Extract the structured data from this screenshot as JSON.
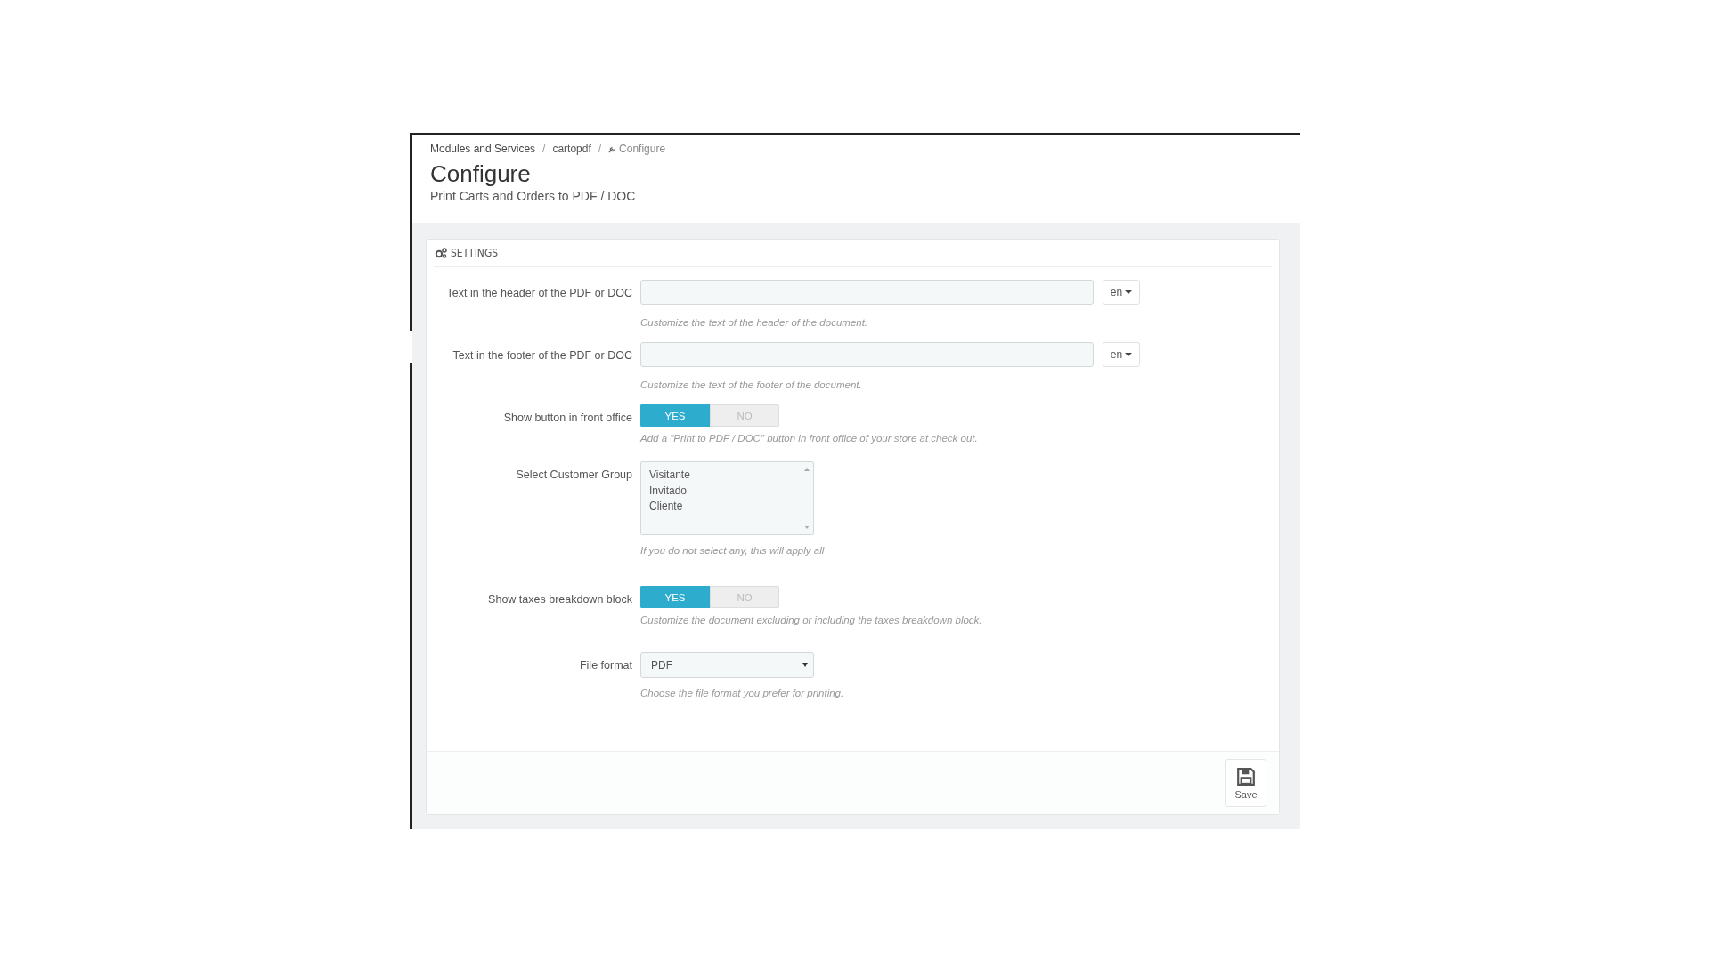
{
  "breadcrumb": [
    {
      "label": "Modules and Services",
      "kind": "link"
    },
    {
      "separator": "/",
      "label": "cartopdf",
      "kind": "link"
    },
    {
      "separator": "/",
      "label": "Configure",
      "kind": "current"
    }
  ],
  "page": {
    "title": "Configure",
    "subtitle": "Print Carts and Orders to PDF / DOC"
  },
  "panel": {
    "title": "SETTINGS"
  },
  "fields": [
    {
      "kind": "text",
      "label": "Text in the header of the PDF or DOC",
      "language": "en",
      "help": "Customize the text of the header of the document."
    },
    {
      "kind": "text",
      "label": "Text in the footer of the PDF or DOC",
      "language": "en",
      "help": "Customize the text of the footer of the document."
    },
    {
      "kind": "toggle",
      "label": "Show button in front office",
      "options": [
        {
          "label": "YES",
          "selected": true
        },
        {
          "label": "NO",
          "selected": false
        }
      ],
      "help": "Add a \"Print to PDF / DOC\" button in front office of your store at check out."
    },
    {
      "kind": "listbox",
      "label": "Select Customer Group",
      "items": [
        "Visitante",
        "Invitado",
        "Cliente"
      ],
      "help": "If you do not select any, this will apply all"
    },
    {
      "kind": "toggle",
      "label": "Show taxes breakdown block",
      "options": [
        {
          "label": "YES",
          "selected": true
        },
        {
          "label": "NO",
          "selected": false
        }
      ],
      "help": "Customize the document excluding or including the taxes breakdown block."
    },
    {
      "kind": "select",
      "label": "File format",
      "value": "PDF",
      "help": "Choose the file format you prefer for printing."
    }
  ],
  "save_button": {
    "label": "Save"
  }
}
